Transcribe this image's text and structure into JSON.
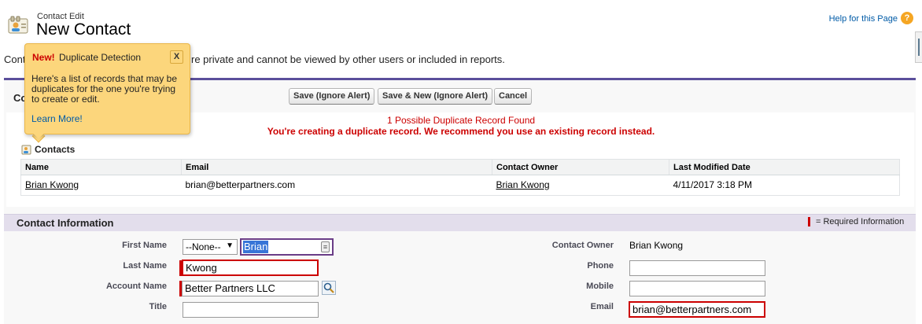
{
  "header": {
    "kicker": "Contact Edit",
    "title": "New Contact",
    "help_label": "Help for this Page",
    "help_icon": "?",
    "description_start": "Cont",
    "description_rest": "re private and cannot be viewed by other users or included in reports."
  },
  "edit_block": {
    "heading_partial": "Co",
    "buttons": {
      "save": "Save (Ignore Alert)",
      "save_new": "Save & New (Ignore Alert)",
      "cancel": "Cancel"
    }
  },
  "duplicates": {
    "title": "1 Possible Duplicate Record Found",
    "message": "You're creating a duplicate record. We recommend you use an existing record instead.",
    "section_label": "Contacts",
    "columns": [
      "Name",
      "Email",
      "Contact Owner",
      "Last Modified Date"
    ],
    "rows": [
      {
        "name": "Brian Kwong",
        "email": "brian@betterpartners.com",
        "owner": "Brian Kwong",
        "modified": "4/11/2017 3:18 PM"
      }
    ]
  },
  "popup": {
    "badge": "New!",
    "title": "Duplicate Detection",
    "close": "X",
    "body": "Here's a list of records that may be duplicates for the one you're trying to create or edit.",
    "link": "Learn More!"
  },
  "contact_info": {
    "section_title": "Contact Information",
    "required_legend": "= Required Information",
    "left": {
      "first_name_label": "First Name",
      "salutation": "--None--",
      "first_name": "Brian",
      "last_name_label": "Last Name",
      "last_name": "Kwong",
      "account_label": "Account Name",
      "account": "Better Partners LLC",
      "title_label": "Title",
      "title": ""
    },
    "right": {
      "owner_label": "Contact Owner",
      "owner": "Brian Kwong",
      "phone_label": "Phone",
      "phone": "",
      "mobile_label": "Mobile",
      "mobile": "",
      "email_label": "Email",
      "email": "brian@betterpartners.com"
    }
  },
  "colors": {
    "accent": "#5b4f9b",
    "error": "#cc0000",
    "popup": "#fcd67c",
    "link": "#015ba7"
  }
}
